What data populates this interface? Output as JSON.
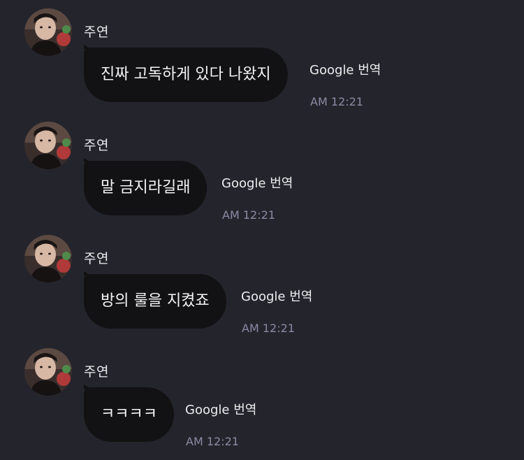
{
  "messages": [
    {
      "sender": "주연",
      "text": "진짜 고독하게 있다 나왔지",
      "translate_label": "Google 번역",
      "time": "AM 12:21"
    },
    {
      "sender": "주연",
      "text": "말 금지라길래",
      "translate_label": "Google 번역",
      "time": "AM 12:21"
    },
    {
      "sender": "주연",
      "text": "방의 룰을 지켰죠",
      "translate_label": "Google 번역",
      "time": "AM 12:21"
    },
    {
      "sender": "주연",
      "text": "ㅋㅋㅋㅋ",
      "translate_label": "Google 번역",
      "time": "AM 12:21"
    }
  ],
  "colors": {
    "background": "#24242c",
    "bubble": "#121214",
    "bubble_text": "#f4f4f6",
    "name_text": "#ececf0",
    "time_text": "#8a8ba3"
  },
  "icons": {
    "avatar": "profile-photo"
  }
}
